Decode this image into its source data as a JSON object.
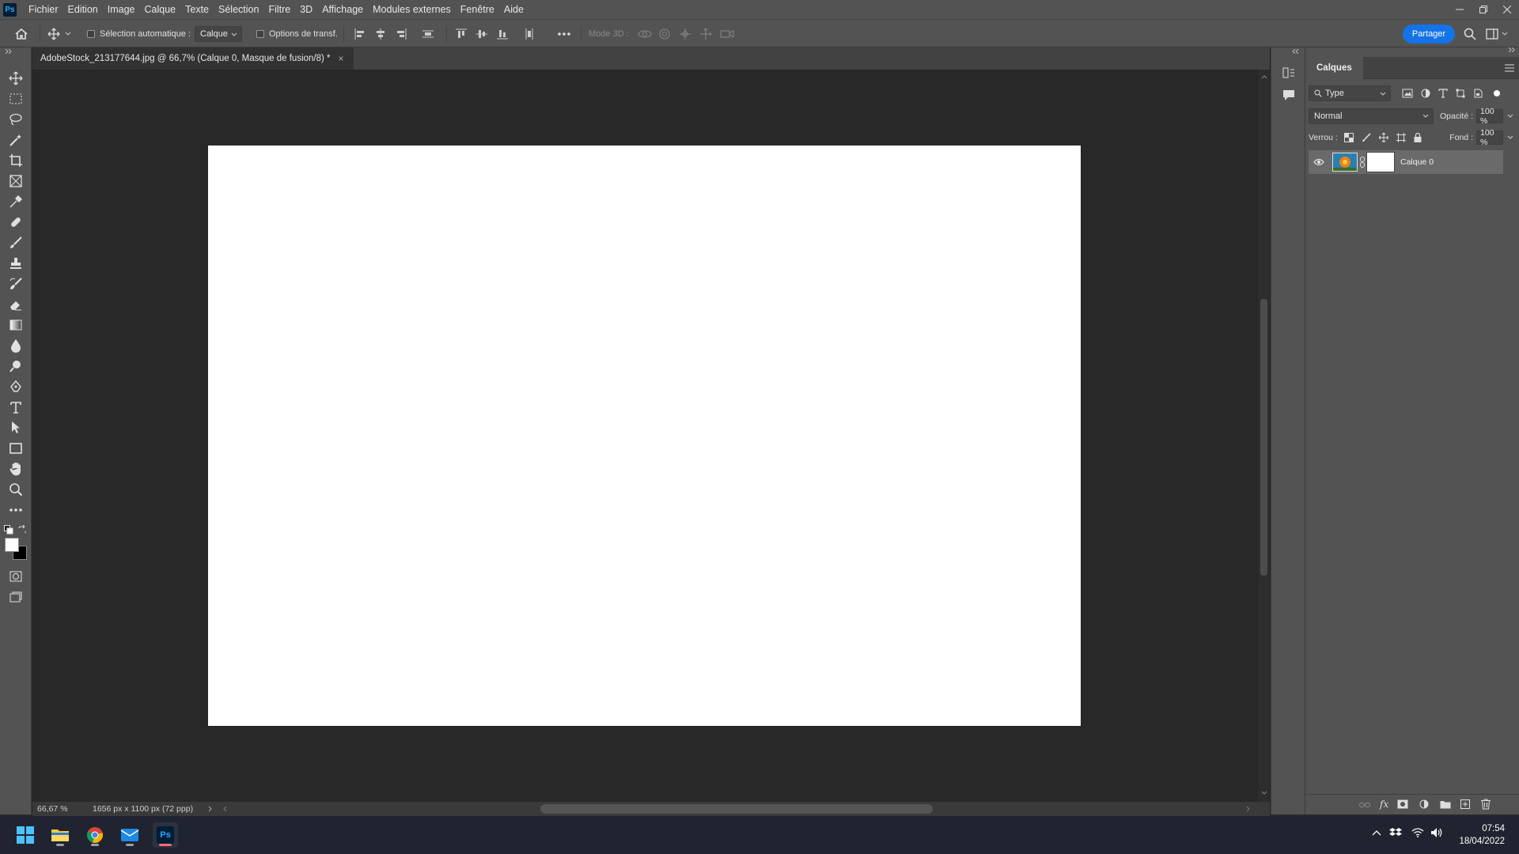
{
  "app": {
    "logo_text": "Ps"
  },
  "menu": [
    "Fichier",
    "Edition",
    "Image",
    "Calque",
    "Texte",
    "Sélection",
    "Filtre",
    "3D",
    "Affichage",
    "Modules externes",
    "Fenêtre",
    "Aide"
  ],
  "options_bar": {
    "auto_select_label": "Sélection automatique :",
    "auto_select_target": "Calque",
    "transform_options_label": "Options de transf.",
    "mode3d_label": "Mode 3D :",
    "share_label": "Partager"
  },
  "document": {
    "tab_title": "AdobeStock_213177644.jpg @ 66,7% (Calque 0, Masque de fusion/8) *",
    "tab_close": "×"
  },
  "status_bar": {
    "zoom": "66,67 %",
    "doc_info": "1656 px x 1100 px (72 ppp)"
  },
  "layers_panel": {
    "tab_label": "Calques",
    "filter_type": "Type",
    "blend_mode": "Normal",
    "opacity_label": "Opacité :",
    "opacity_value": "100 %",
    "lock_label": "Verrou :",
    "fill_label": "Fond :",
    "fill_value": "100 %",
    "layers": [
      {
        "name": "Calque 0",
        "visible": true
      }
    ],
    "footer_fx": "fx"
  },
  "taskbar": {
    "time": "07:54",
    "date": "18/04/2022"
  },
  "colors": {
    "accent": "#1473e6",
    "panel_bg": "#535353",
    "canvas_bg": "#282828",
    "document": "#ffffff"
  }
}
